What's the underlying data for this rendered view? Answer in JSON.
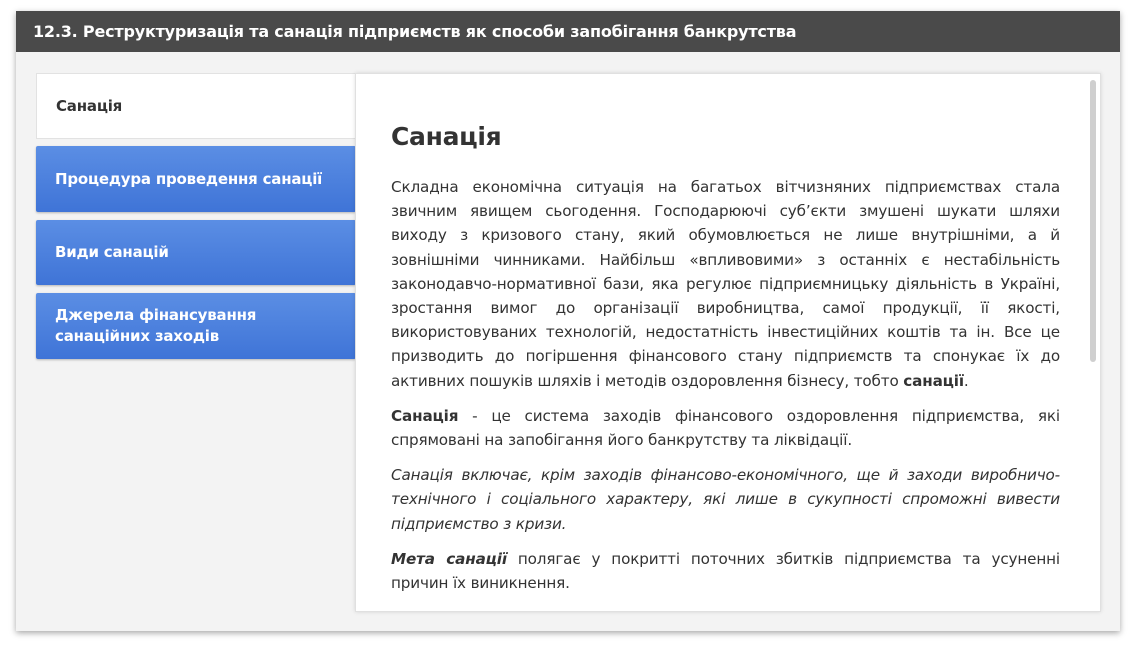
{
  "window": {
    "title": "12.3. Реструктуризація та санація підприємств як способи запобігання банкрутства"
  },
  "tabs": [
    {
      "label": "Санація",
      "active": true
    },
    {
      "label": "Процедура проведення санації",
      "active": false
    },
    {
      "label": "Види санацій",
      "active": false
    },
    {
      "label": "Джерела фінансування санаційних заходів",
      "active": false
    }
  ],
  "content": {
    "heading": "Санація",
    "p1": "Складна економічна ситуація на багатьох вітчизняних підприємствах  стала звичним явищем сьогодення. Господарюючі суб’єкти змушені шукати  шляхи виходу з кризового стану, який обумовлюється не лише внутрішніми, а й зовнішніми чинниками. Найбільш «впливовими» з останніх є нестабільність законодавчо-нормативної бази, яка регулює підприємницьку діяльність в Україні, зростання вимог до організації виробництва, самої продукції, її якості, використовуваних технологій, недостатність інвестиційних коштів та ін. Все це призводить до погіршення фінансового стану підприємств та спонукає їх до активних пошуків шляхів і методів оздоровлення бізнесу, тобто ",
    "p1_bold": "санації",
    "p1_end": ".",
    "p2_bold": "Санація",
    "p2": " - це система заходів фінансового оздоровлення  підприємства, які спрямовані на запобігання його банкрутству та ліквідації.",
    "p3": "Санація включає, крім заходів фінансово-економічного, ще й заходи виробничо-технічного і соціального характеру, які лише в сукупності  спроможні вивести підприємство з кризи.",
    "p4_bold": "Мета санації",
    "p4": " полягає у покритті поточних збитків підприємства та усуненні причин їх виникнення."
  },
  "colors": {
    "titlebar": "#4a4a4a",
    "tab_blue": "#4a7fdc",
    "text": "#333333"
  }
}
